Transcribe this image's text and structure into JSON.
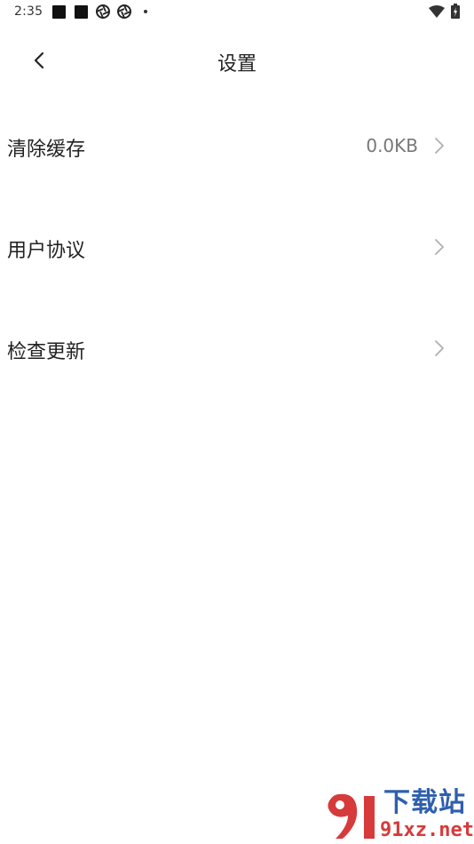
{
  "status_bar": {
    "time": "2:35"
  },
  "header": {
    "title": "设置"
  },
  "settings": [
    {
      "label": "清除缓存",
      "value": "0.0KB"
    },
    {
      "label": "用户协议",
      "value": ""
    },
    {
      "label": "检查更新",
      "value": ""
    }
  ],
  "watermark": {
    "title": "下载站",
    "url": "91xz.net"
  },
  "icons": {
    "back": "chevron-left-icon",
    "row_arrow": "chevron-right-icon",
    "wifi": "wifi-icon",
    "battery": "battery-icon"
  },
  "colors": {
    "text": "#222222",
    "secondary_text": "#777777",
    "chevron": "#b0b0b0",
    "watermark_blue": "#2f5fae",
    "watermark_red": "#d63a3a"
  }
}
